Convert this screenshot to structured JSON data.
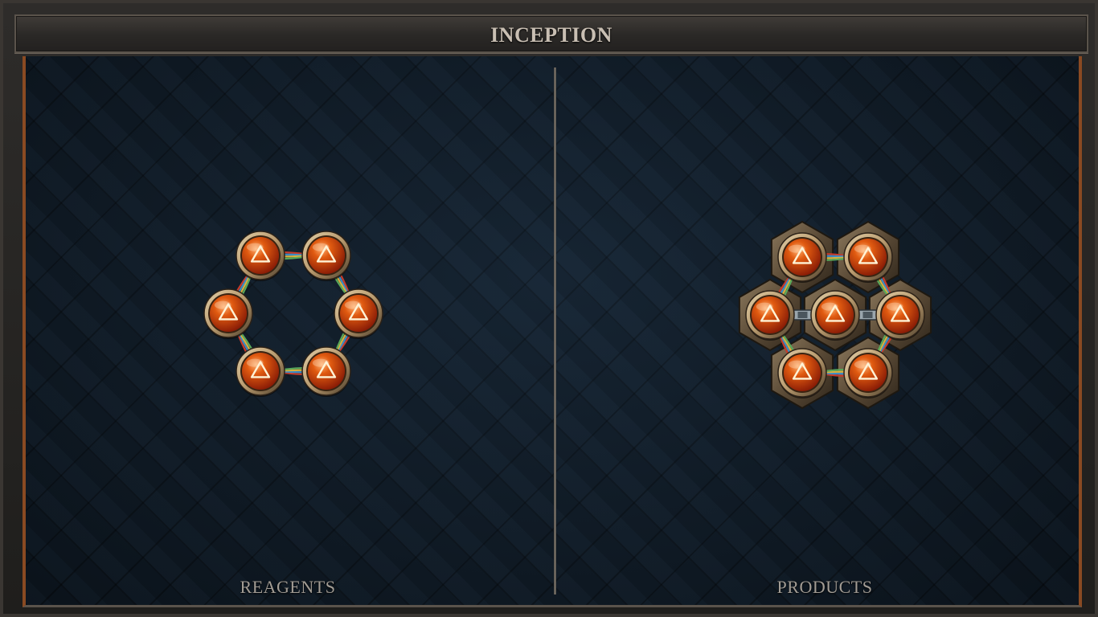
{
  "window": {
    "title": "INCEPTION"
  },
  "panels": {
    "reagents": {
      "label": "REAGENTS",
      "item": {
        "socket_color": "red",
        "socket_icon": "strength-triangle-icon",
        "socket_count": 6,
        "link_count": 6,
        "item_background": "none"
      }
    },
    "products": {
      "label": "PRODUCTS",
      "item": {
        "socket_color": "red",
        "socket_icon": "strength-triangle-icon",
        "socket_count": 7,
        "link_count": 8,
        "item_background": "hex-bronze-plate"
      }
    }
  },
  "colors": {
    "socket_gem": "#e05a10",
    "socket_gem_dark": "#8a1c06",
    "socket_rim": "#b89a6e",
    "frame_accent": "#8a4a22",
    "board_bg": "#101c28",
    "title_text": "#c9bfb3",
    "label_text": "#a29c94"
  }
}
